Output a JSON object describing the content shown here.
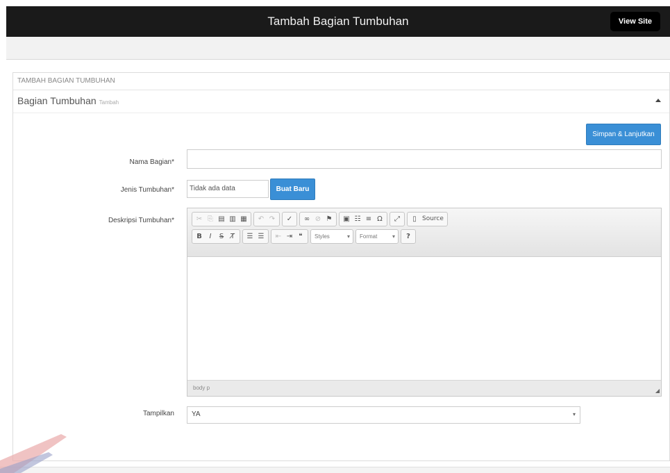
{
  "header": {
    "title": "Tambah Bagian Tumbuhan",
    "view_site": "View Site"
  },
  "breadcrumb": "TAMBAH BAGIAN TUMBUHAN",
  "section": {
    "title": "Bagian Tumbuhan",
    "subtitle": "Tambah"
  },
  "actions": {
    "save_label": "Simpan & Lanjutkan"
  },
  "form": {
    "nama": {
      "label": "Nama Bagian*",
      "value": ""
    },
    "jenis": {
      "label": "Jenis Tumbuhan*",
      "value": "Tidak ada data",
      "button": "Buat Baru"
    },
    "deskripsi": {
      "label": "Deskripsi Tumbuhan*"
    },
    "tampilkan": {
      "label": "Tampilkan",
      "value": "YA"
    }
  },
  "editor": {
    "toolbar_row1": [
      "cut-icon",
      "copy-icon",
      "paste-icon",
      "paste-text-icon",
      "paste-word-icon",
      "undo-icon",
      "redo-icon",
      "spellcheck-icon",
      "link-icon",
      "unlink-icon",
      "anchor-icon",
      "image-icon",
      "table-icon",
      "horizontal-rule-icon",
      "special-char-icon",
      "maximize-icon",
      "source-icon"
    ],
    "source_label": "Source",
    "styles_label": "Styles",
    "format_label": "Format",
    "status_text": "body p"
  },
  "colors": {
    "topbar": "#1a1a1a",
    "primary": "#3a8fd6"
  }
}
